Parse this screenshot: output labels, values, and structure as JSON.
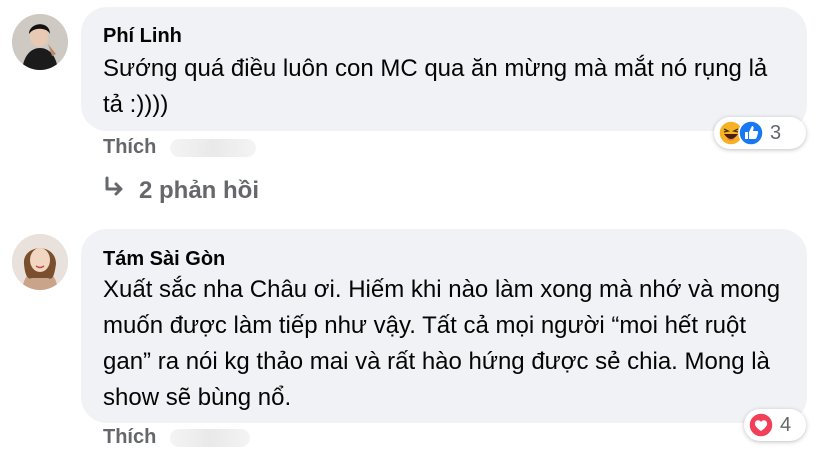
{
  "comments": [
    {
      "author": "Phí Linh",
      "text": "Sướng quá điều luôn con MC qua ăn mừng mà mắt nó rụng lả tả :))))",
      "like_label": "Thích",
      "reaction_count": "3",
      "reaction_icons": [
        "haha-emoji-icon",
        "like-thumb-icon"
      ],
      "replies_label": "2 phản hồi"
    },
    {
      "author": "Tám Sài Gòn",
      "text": "Xuất sắc nha Châu ơi. Hiếm khi nào làm xong mà nhớ và mong muốn được làm tiếp như vậy. Tất cả mọi người “moi hết ruột gan” ra nói kg thảo mai và rất hào hứng được sẻ chia. Mong là show sẽ bùng nổ.",
      "like_label": "Thích",
      "reaction_count": "4",
      "reaction_icons": [
        "love-heart-icon"
      ]
    }
  ],
  "colors": {
    "bubble_bg": "#f0f2f5",
    "secondary_text": "#65676b",
    "like_blue": "#1877f2",
    "love_red": "#f33e58",
    "haha_yellow": "#f7b125"
  }
}
